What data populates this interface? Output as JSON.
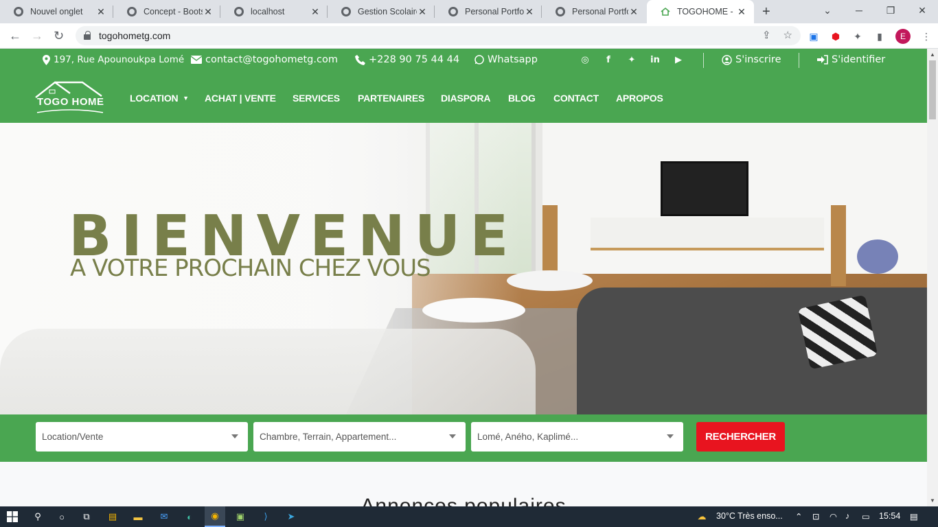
{
  "browser": {
    "tabs": [
      {
        "title": "Nouvel onglet",
        "active": false
      },
      {
        "title": "Concept - Bootst",
        "active": false
      },
      {
        "title": "localhost",
        "active": false
      },
      {
        "title": "Gestion Scolaire",
        "active": false
      },
      {
        "title": "Personal Portfolio",
        "active": false
      },
      {
        "title": "Personal Portfolio",
        "active": false
      },
      {
        "title": "TOGOHOME - Le",
        "active": true
      }
    ],
    "new_tab": "+",
    "url": "togohometg.com",
    "profile_initial": "E",
    "window_controls": {
      "minimize": "─",
      "maximize": "❐",
      "close": "✕",
      "tab_search": "⌄"
    }
  },
  "topbar": {
    "address": "197, Rue Apounoukpa Lomé",
    "email": "contact@togohometg.com",
    "phone": "+228 90 75 44 44",
    "whatsapp": "Whatsapp",
    "social": [
      "instagram-icon",
      "facebook-icon",
      "twitter-icon",
      "linkedin-icon",
      "youtube-icon"
    ],
    "register": "S'inscrire",
    "login": "S'identifier"
  },
  "nav": {
    "logo_text": "TOGO HOME",
    "items": [
      "LOCATION",
      "ACHAT | VENTE",
      "SERVICES",
      "PARTENAIRES",
      "DIASPORA",
      "BLOG",
      "CONTACT",
      "APROPOS"
    ]
  },
  "hero": {
    "title": "BIENVENUE",
    "subtitle": "A VOTRE PROCHAIN CHEZ VOUS"
  },
  "search": {
    "type_placeholder": "Location/Vente",
    "property_placeholder": "Chambre, Terrain, Appartement...",
    "city_placeholder": "Lomé, Aného, Kaplimé...",
    "button": "RECHERCHER"
  },
  "section_title": "Annonces populaires",
  "taskbar": {
    "weather": "30°C  Très enso...",
    "time": "15:54"
  },
  "colors": {
    "brand_green": "#4aa651",
    "hero_text": "#787f4a",
    "search_button": "#e8141f"
  }
}
